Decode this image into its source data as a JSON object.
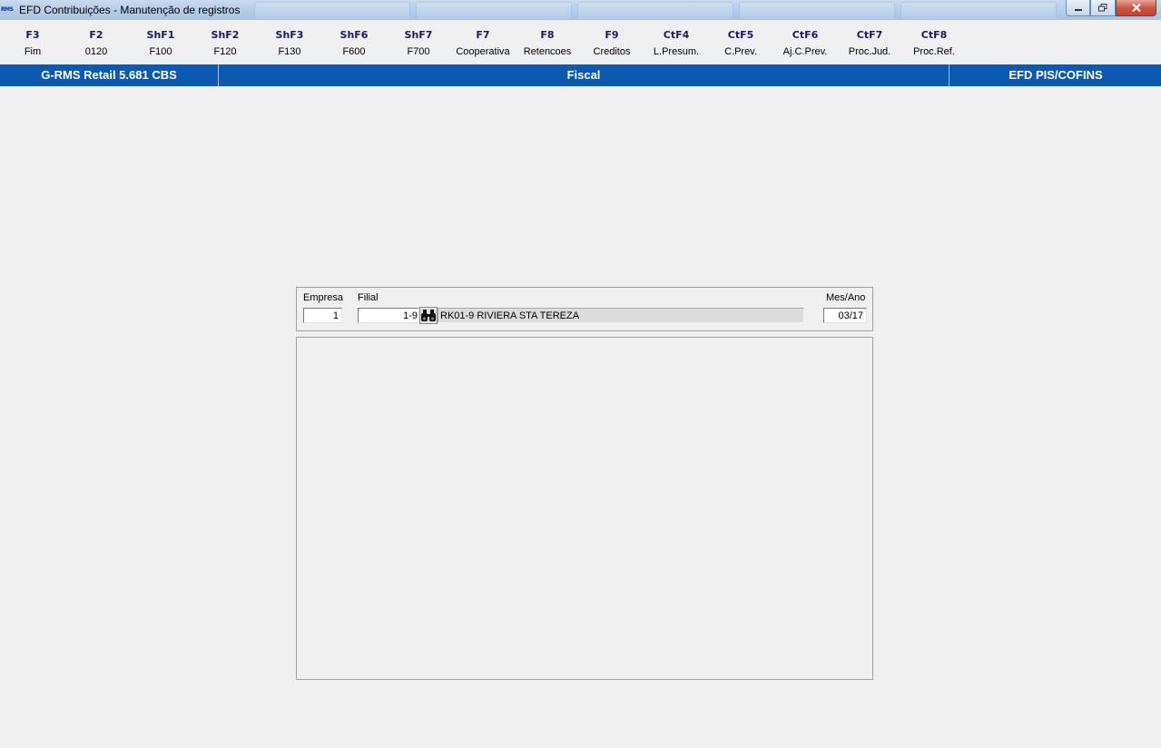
{
  "window": {
    "title": "EFD Contribuições - Manutenção de registros",
    "app_icon_text": "RMS",
    "minimize_icon": "minimize-icon",
    "restore_icon": "restore-icon",
    "close_icon": "close-icon"
  },
  "fkeys": [
    {
      "key": "F3",
      "label": "Fim"
    },
    {
      "key": "F2",
      "label": "0120"
    },
    {
      "key": "ShF1",
      "label": "F100"
    },
    {
      "key": "ShF2",
      "label": "F120"
    },
    {
      "key": "ShF3",
      "label": "F130"
    },
    {
      "key": "ShF6",
      "label": "F600"
    },
    {
      "key": "ShF7",
      "label": "F700"
    },
    {
      "key": "F7",
      "label": "Cooperativa"
    },
    {
      "key": "F8",
      "label": "Retencoes"
    },
    {
      "key": "F9",
      "label": "Creditos"
    },
    {
      "key": "CtF4",
      "label": "L.Presum."
    },
    {
      "key": "CtF5",
      "label": "C.Prev."
    },
    {
      "key": "CtF6",
      "label": "Aj.C.Prev."
    },
    {
      "key": "CtF7",
      "label": "Proc.Jud."
    },
    {
      "key": "CtF8",
      "label": "Proc.Ref."
    }
  ],
  "header": {
    "left": "G-RMS Retail 5.681 CBS",
    "center": "Fiscal",
    "right": "EFD PIS/COFINS",
    "color": "#0b59b0"
  },
  "filter": {
    "empresa_label": "Empresa",
    "empresa_value": "1",
    "filial_label": "Filial",
    "filial_value": "1-9",
    "filial_lookup_icon": "binoculars-icon",
    "filial_description": "RK01-9 RIVIERA STA TEREZA",
    "mesano_label": "Mes/Ano",
    "mesano_value": "03/17"
  }
}
